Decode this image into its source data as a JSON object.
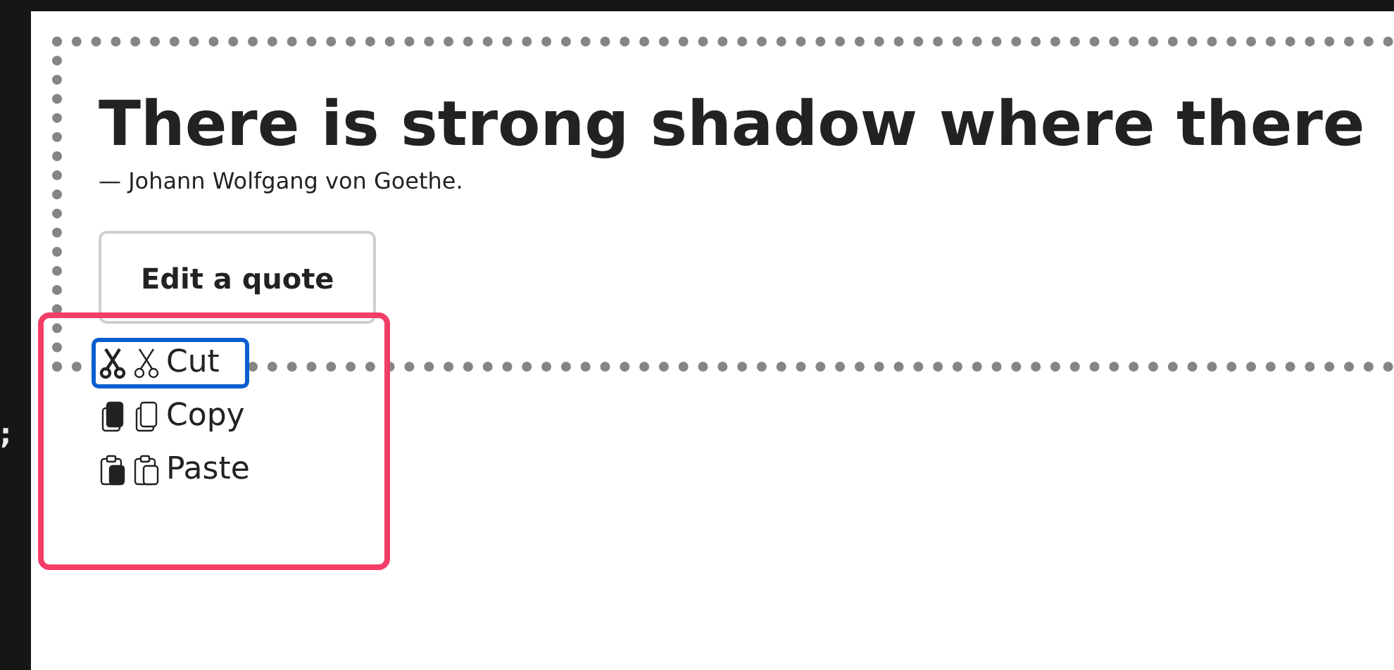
{
  "editor_gutter": {
    "text": ";"
  },
  "quote": {
    "text": "There is strong shadow where there",
    "attribution": "— Johann Wolfgang von Goethe."
  },
  "edit_button": {
    "label": "Edit a quote"
  },
  "context_menu": {
    "items": [
      {
        "kind": "cut",
        "label": "Cut",
        "selected": true
      },
      {
        "kind": "copy",
        "label": "Copy",
        "selected": false
      },
      {
        "kind": "paste",
        "label": "Paste",
        "selected": false
      }
    ]
  }
}
